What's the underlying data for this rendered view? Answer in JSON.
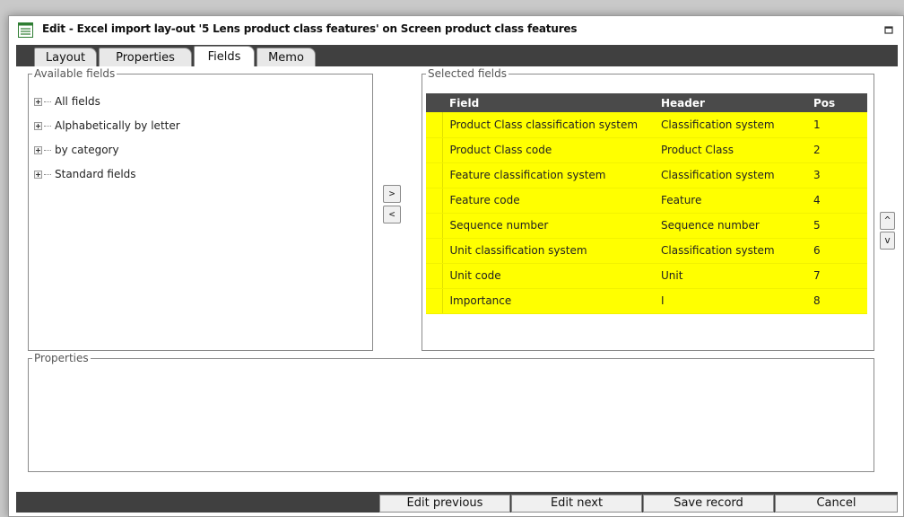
{
  "window": {
    "title": "Edit - Excel import lay-out '5 Lens product class features' on Screen product class features"
  },
  "tabs": [
    {
      "label": "Layout"
    },
    {
      "label": "Properties"
    },
    {
      "label": "Fields"
    },
    {
      "label": "Memo"
    }
  ],
  "available_fields": {
    "legend": "Available fields",
    "items": [
      {
        "label": "All fields"
      },
      {
        "label": "Alphabetically by letter"
      },
      {
        "label": "by category"
      },
      {
        "label": "Standard fields"
      }
    ]
  },
  "transfer_buttons": {
    "add": ">",
    "remove": "<"
  },
  "order_buttons": {
    "up": "^",
    "down": "v"
  },
  "selected_fields": {
    "legend": "Selected fields",
    "columns": [
      "Field",
      "Header",
      "Pos"
    ],
    "rows": [
      {
        "field": "Product Class classification system",
        "header": "Classification system",
        "pos": "1"
      },
      {
        "field": "Product Class code",
        "header": "Product Class",
        "pos": "2"
      },
      {
        "field": "Feature classification system",
        "header": "Classification system",
        "pos": "3"
      },
      {
        "field": "Feature code",
        "header": "Feature",
        "pos": "4"
      },
      {
        "field": "Sequence number",
        "header": "Sequence number",
        "pos": "5"
      },
      {
        "field": "Unit classification system",
        "header": "Classification system",
        "pos": "6"
      },
      {
        "field": "Unit code",
        "header": "Unit",
        "pos": "7"
      },
      {
        "field": "Importance",
        "header": "I",
        "pos": "8"
      }
    ]
  },
  "properties": {
    "legend": "Properties"
  },
  "footer": {
    "edit_previous": "Edit previous",
    "edit_next": "Edit next",
    "save_record": "Save record",
    "cancel": "Cancel"
  },
  "colors": {
    "selected_row": "#ffff00",
    "chrome": "#404040",
    "grid_header": "#4a4a4a"
  }
}
